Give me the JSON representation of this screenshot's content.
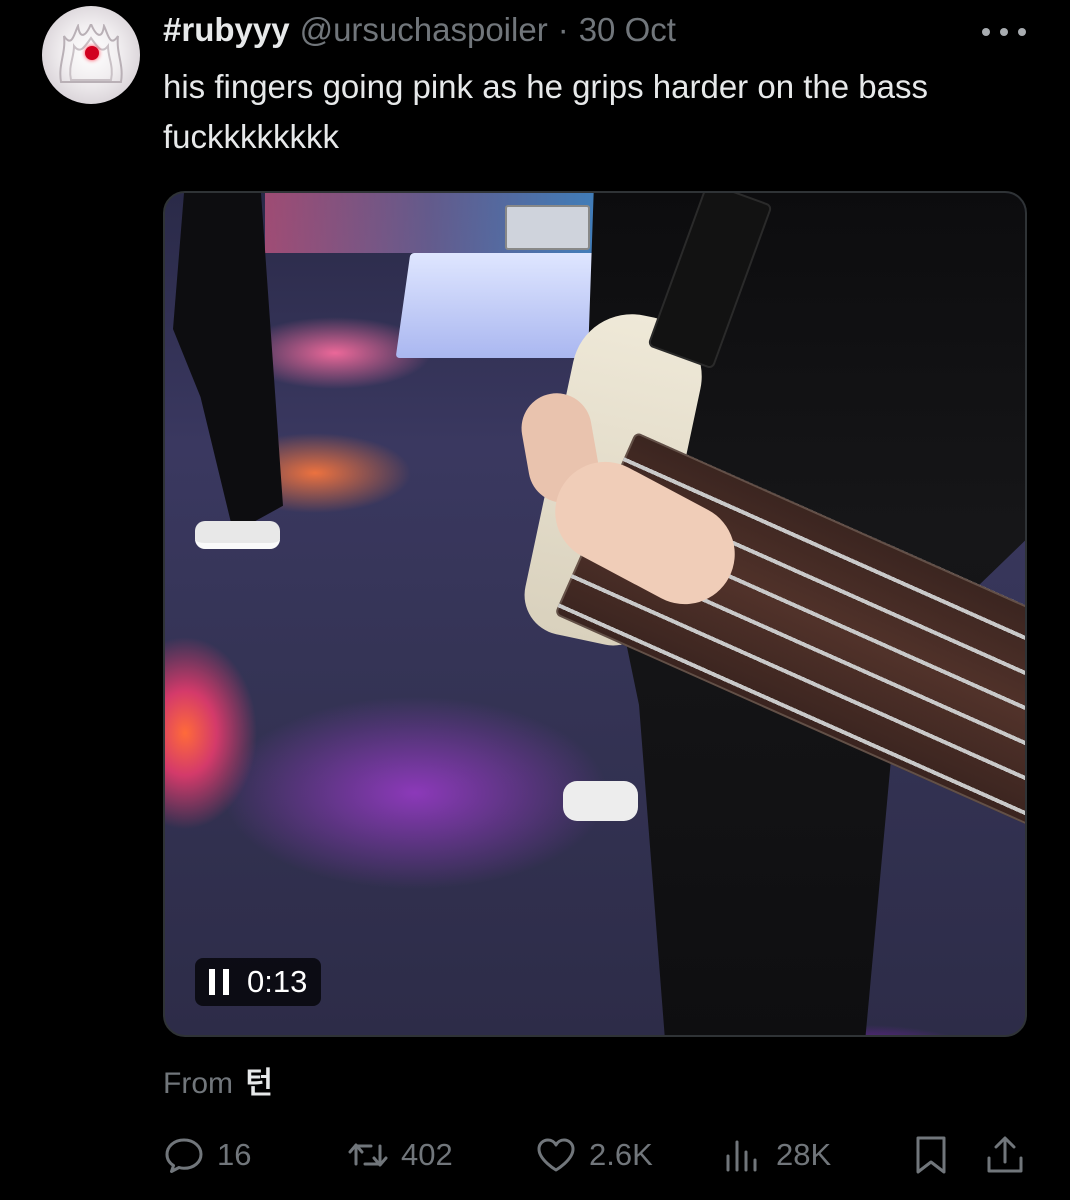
{
  "tweet": {
    "display_name": "#rubyyy",
    "handle": "@ursuchaspoiler",
    "separator": "·",
    "date": "30 Oct",
    "text": "his fingers going pink as he grips harder on the bass fuckkkkkkkk"
  },
  "media": {
    "video_time": "0:13",
    "state": "playing"
  },
  "from": {
    "label": "From",
    "source": "턴"
  },
  "actions": {
    "replies": "16",
    "reposts": "402",
    "likes": "2.6K",
    "views": "28K"
  },
  "icons": [
    "more-icon",
    "pause-icon",
    "reply-icon",
    "repost-icon",
    "like-icon",
    "views-icon",
    "bookmark-icon",
    "share-icon"
  ],
  "colors": {
    "background": "#000000",
    "text_primary": "#e7e9ea",
    "text_secondary": "#71767b"
  }
}
